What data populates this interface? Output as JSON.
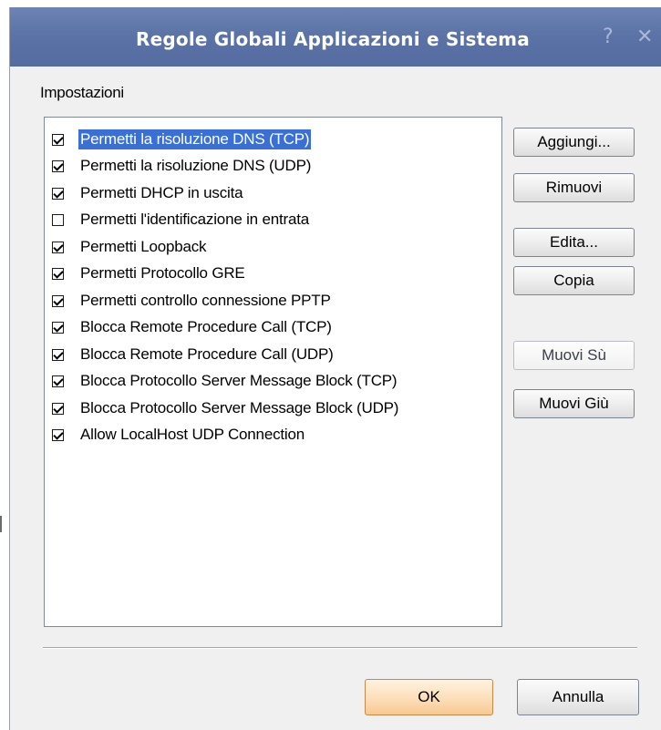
{
  "window": {
    "title": "Regole Globali Applicazioni e Sistema",
    "help_glyph": "?",
    "close_glyph": "✕"
  },
  "group": {
    "label": "Impostazioni"
  },
  "rules": [
    {
      "label": "Permetti la risoluzione DNS (TCP)",
      "checked": true,
      "selected": true
    },
    {
      "label": "Permetti la risoluzione DNS (UDP)",
      "checked": true,
      "selected": false
    },
    {
      "label": "Permetti DHCP in uscita",
      "checked": true,
      "selected": false
    },
    {
      "label": "Permetti l'identificazione in entrata",
      "checked": false,
      "selected": false
    },
    {
      "label": "Permetti Loopback",
      "checked": true,
      "selected": false
    },
    {
      "label": "Permetti Protocollo GRE",
      "checked": true,
      "selected": false
    },
    {
      "label": "Permetti controllo connessione PPTP",
      "checked": true,
      "selected": false
    },
    {
      "label": "Blocca Remote Procedure Call (TCP)",
      "checked": true,
      "selected": false
    },
    {
      "label": "Blocca Remote Procedure Call (UDP)",
      "checked": true,
      "selected": false
    },
    {
      "label": "Blocca Protocollo Server Message Block (TCP)",
      "checked": true,
      "selected": false
    },
    {
      "label": "Blocca Protocollo Server Message Block (UDP)",
      "checked": true,
      "selected": false
    },
    {
      "label": "Allow LocalHost UDP Connection",
      "checked": true,
      "selected": false
    }
  ],
  "side_buttons": {
    "add": "Aggiungi...",
    "remove": "Rimuovi",
    "edit": "Edita...",
    "copy": "Copia",
    "move_up": "Muovi Sù",
    "move_down": "Muovi Giù"
  },
  "footer": {
    "ok": "OK",
    "cancel": "Annulla"
  },
  "colors": {
    "titlebar": "#5a72a6",
    "selection": "#3a6fd6",
    "ok_button": "#fde0bc"
  }
}
